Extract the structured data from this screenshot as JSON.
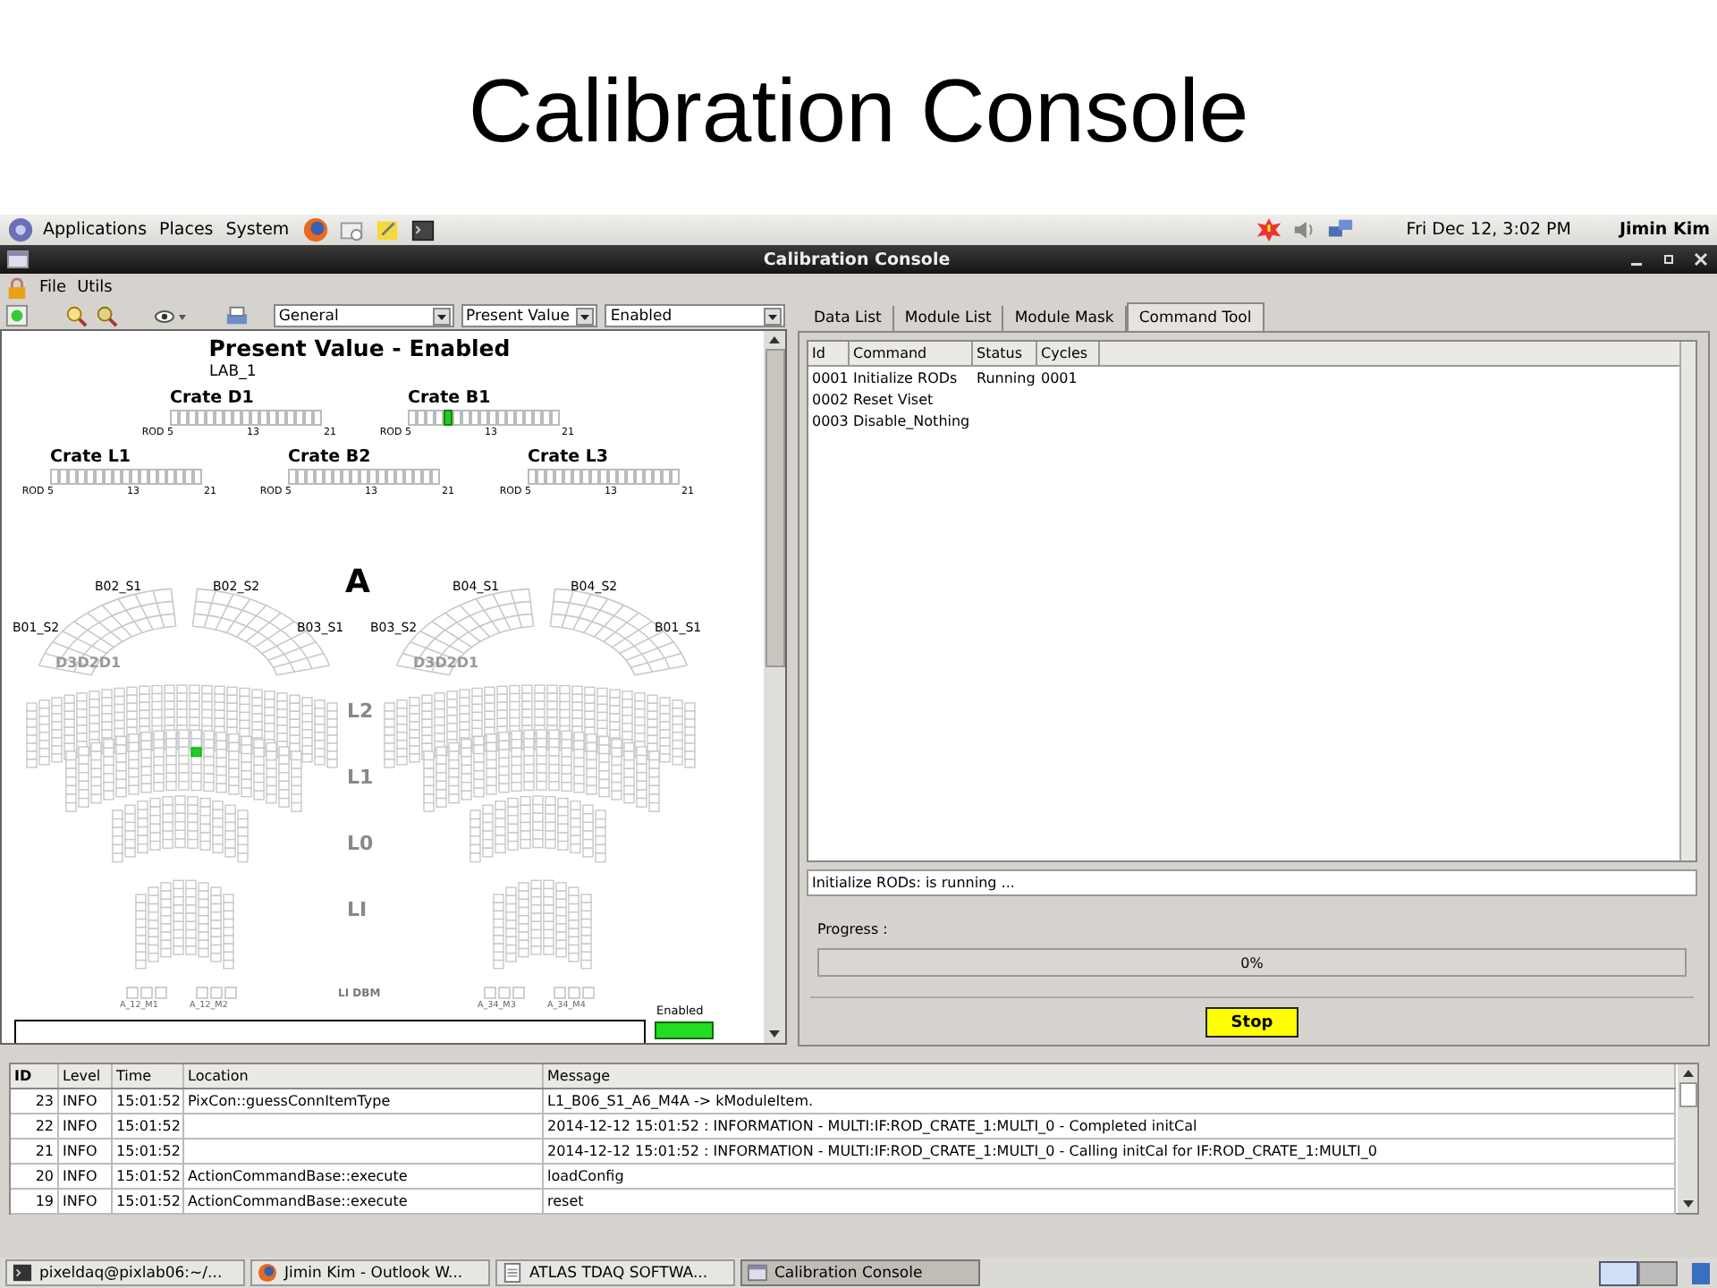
{
  "slide_title": "Calibration Console",
  "top_panel": {
    "menus": [
      "Applications",
      "Places",
      "System"
    ],
    "clock": "Fri Dec 12,  3:02 PM",
    "user": "Jimin Kim"
  },
  "window": {
    "title": "Calibration Console"
  },
  "menu": [
    "File",
    "Utils"
  ],
  "toolbar": {
    "dropdowns": [
      "General",
      "Present Value",
      "Enabled"
    ]
  },
  "map": {
    "title": "Present Value - Enabled",
    "subtitle": "LAB_1",
    "crates": [
      {
        "name": "Crate D1",
        "ticks": [
          "ROD 5",
          "13",
          "21"
        ],
        "slots": [
          false,
          false,
          false,
          false,
          false,
          false,
          false,
          false,
          false,
          false,
          false,
          false,
          false,
          false,
          false,
          false,
          false
        ]
      },
      {
        "name": "Crate B1",
        "ticks": [
          "ROD 5",
          "13",
          "21"
        ],
        "slots": [
          false,
          false,
          false,
          false,
          true,
          false,
          false,
          false,
          false,
          false,
          false,
          false,
          false,
          false,
          false,
          false,
          false
        ]
      },
      {
        "name": "Crate L1",
        "ticks": [
          "ROD 5",
          "13",
          "21"
        ],
        "slots": [
          false,
          false,
          false,
          false,
          false,
          false,
          false,
          false,
          false,
          false,
          false,
          false,
          false,
          false,
          false,
          false,
          false
        ]
      },
      {
        "name": "Crate B2",
        "ticks": [
          "ROD 5",
          "13",
          "21"
        ],
        "slots": [
          false,
          false,
          false,
          false,
          false,
          false,
          false,
          false,
          false,
          false,
          false,
          false,
          false,
          false,
          false,
          false,
          false
        ]
      },
      {
        "name": "Crate L3",
        "ticks": [
          "ROD 5",
          "13",
          "21"
        ],
        "slots": [
          false,
          false,
          false,
          false,
          false,
          false,
          false,
          false,
          false,
          false,
          false,
          false,
          false,
          false,
          false,
          false,
          false
        ]
      }
    ],
    "side": "A",
    "sector_labels": [
      "B02_S1",
      "B02_S2",
      "B01_S2",
      "B03_S1",
      "B03_S2",
      "B04_S1",
      "B04_S2",
      "B01_S1"
    ],
    "disk_labels": [
      "D3D2D1",
      "D3D2D1"
    ],
    "layers": [
      "L2",
      "L1",
      "L0",
      "LI"
    ],
    "dbm_label": "LI DBM",
    "dbm_modules": [
      "A_12_M1",
      "A_12_M2",
      "A_34_M3",
      "A_34_M4"
    ],
    "legend": "Enabled"
  },
  "tabs": [
    {
      "label": "Data List",
      "selected": false
    },
    {
      "label": "Module List",
      "selected": false
    },
    {
      "label": "Module Mask",
      "selected": false
    },
    {
      "label": "Command Tool",
      "selected": true
    }
  ],
  "commands": {
    "columns": [
      "Id",
      "Command",
      "Status",
      "Cycles"
    ],
    "rows": [
      [
        "0001",
        "Initialize RODs",
        "Running",
        "0001"
      ],
      [
        "0002",
        "Reset Viset",
        "",
        ""
      ],
      [
        "0003",
        "Disable_Nothing",
        "",
        ""
      ]
    ]
  },
  "status_line": "Initialize RODs: is running ...",
  "progress": {
    "label": "Progress :",
    "level": 0,
    "reading": "0%"
  },
  "stop_button": "Stop",
  "log": {
    "columns": [
      "ID",
      "Level",
      "Time",
      "Location",
      "Message"
    ],
    "rows": [
      [
        "23",
        "INFO",
        "15:01:52",
        "PixCon::guessConnItemType",
        "L1_B06_S1_A6_M4A -> kModuleItem."
      ],
      [
        "22",
        "INFO",
        "15:01:52",
        "",
        "2014-12-12 15:01:52 : INFORMATION - MULTI:IF:ROD_CRATE_1:MULTI_0 - Completed initCal"
      ],
      [
        "21",
        "INFO",
        "15:01:52",
        "",
        "2014-12-12 15:01:52 : INFORMATION - MULTI:IF:ROD_CRATE_1:MULTI_0 - Calling initCal for IF:ROD_CRATE_1:MULTI_0"
      ],
      [
        "20",
        "INFO",
        "15:01:52",
        "ActionCommandBase::execute",
        "loadConfig"
      ],
      [
        "19",
        "INFO",
        "15:01:52",
        "ActionCommandBase::execute",
        "reset"
      ]
    ]
  },
  "taskbar": [
    {
      "label": "pixeldaq@pixlab06:~/...",
      "kind": "terminal",
      "selected": false
    },
    {
      "label": "Jimin Kim - Outlook W...",
      "kind": "browser",
      "selected": false
    },
    {
      "label": "ATLAS TDAQ SOFTWA...",
      "kind": "document",
      "selected": false
    },
    {
      "label": "Calibration Console",
      "kind": "window",
      "selected": true
    }
  ]
}
